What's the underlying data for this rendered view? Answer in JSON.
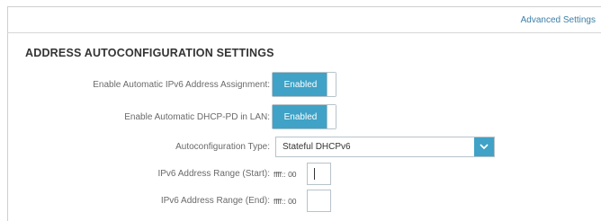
{
  "header": {
    "advanced_settings_link": "Advanced Settings"
  },
  "section": {
    "title": "ADDRESS AUTOCONFIGURATION SETTINGS"
  },
  "rows": {
    "auto_ipv6": {
      "label": "Enable Automatic IPv6 Address Assignment:",
      "value": "Enabled"
    },
    "dhcp_pd": {
      "label": "Enable Automatic DHCP-PD in LAN:",
      "value": "Enabled"
    },
    "autoconfig_type": {
      "label": "Autoconfiguration Type:",
      "selected": "Stateful DHCPv6",
      "icon": "chevron-down-icon"
    },
    "range_start": {
      "label": "IPv6 Address Range (Start):",
      "prefix": "ffff:: 00",
      "value": ""
    },
    "range_end": {
      "label": "IPv6 Address Range (End):",
      "prefix": "ffff:: 00",
      "value": ""
    }
  },
  "colors": {
    "accent": "#3fa2c6",
    "link": "#3d7fa6"
  }
}
